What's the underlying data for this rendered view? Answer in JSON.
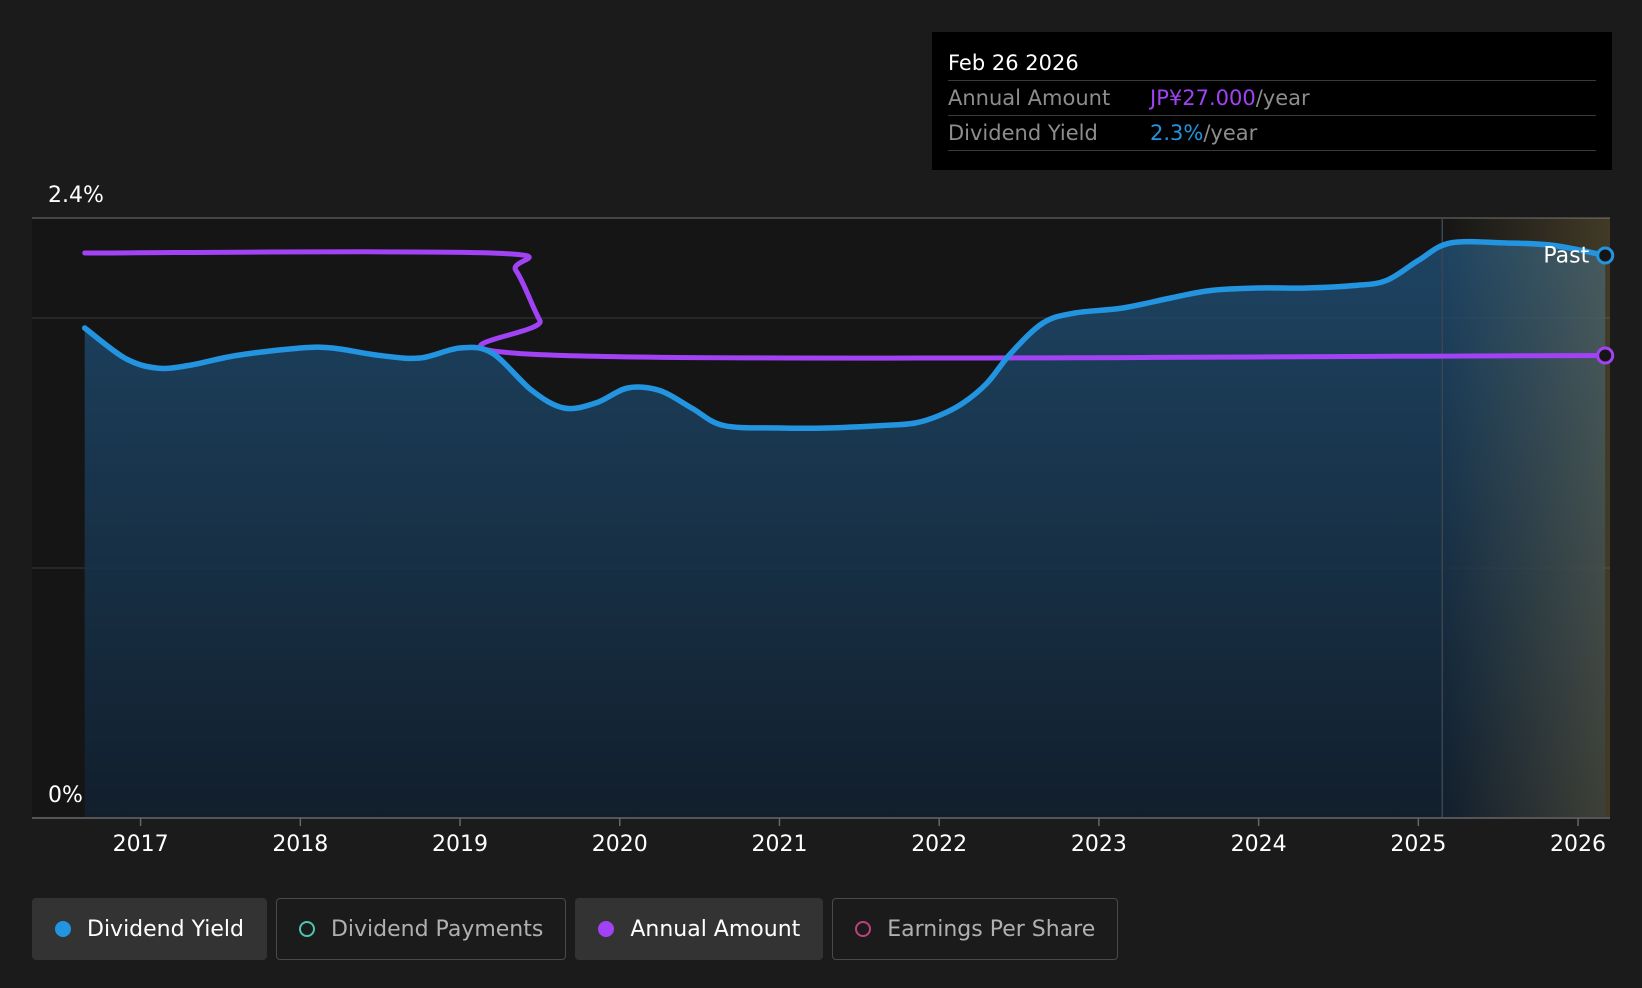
{
  "chart_data": {
    "type": "area",
    "y_tick_labels": [
      "2.4%",
      "0%"
    ],
    "ylim": [
      0,
      2.4
    ],
    "x_tick_labels": [
      "2017",
      "2018",
      "2019",
      "2020",
      "2021",
      "2022",
      "2023",
      "2024",
      "2025",
      "2026"
    ],
    "x_range": [
      2016.32,
      2026.2
    ],
    "past_label": "Past",
    "forecast_start": 2025.15,
    "series": [
      {
        "name": "Dividend Yield",
        "color": "#2394e0",
        "points": [
          [
            2016.65,
            1.96
          ],
          [
            2016.9,
            1.84
          ],
          [
            2017.1,
            1.8
          ],
          [
            2017.3,
            1.81
          ],
          [
            2017.6,
            1.85
          ],
          [
            2018.0,
            1.88
          ],
          [
            2018.2,
            1.88
          ],
          [
            2018.5,
            1.85
          ],
          [
            2018.75,
            1.84
          ],
          [
            2019.0,
            1.88
          ],
          [
            2019.2,
            1.86
          ],
          [
            2019.45,
            1.71
          ],
          [
            2019.65,
            1.64
          ],
          [
            2019.85,
            1.66
          ],
          [
            2020.05,
            1.72
          ],
          [
            2020.25,
            1.71
          ],
          [
            2020.45,
            1.64
          ],
          [
            2020.65,
            1.57
          ],
          [
            2021.0,
            1.56
          ],
          [
            2021.3,
            1.56
          ],
          [
            2021.65,
            1.57
          ],
          [
            2021.85,
            1.58
          ],
          [
            2022.0,
            1.61
          ],
          [
            2022.15,
            1.66
          ],
          [
            2022.3,
            1.74
          ],
          [
            2022.45,
            1.86
          ],
          [
            2022.65,
            1.98
          ],
          [
            2022.85,
            2.02
          ],
          [
            2023.15,
            2.04
          ],
          [
            2023.45,
            2.08
          ],
          [
            2023.7,
            2.11
          ],
          [
            2024.0,
            2.12
          ],
          [
            2024.3,
            2.12
          ],
          [
            2024.6,
            2.13
          ],
          [
            2024.8,
            2.15
          ],
          [
            2025.0,
            2.23
          ],
          [
            2025.2,
            2.3
          ],
          [
            2025.55,
            2.3
          ],
          [
            2025.85,
            2.29
          ],
          [
            2026.17,
            2.25
          ]
        ]
      },
      {
        "name": "Annual Amount",
        "color": "#a142f4",
        "points": [
          [
            2016.65,
            2.26
          ],
          [
            2019.2,
            2.26
          ],
          [
            2019.35,
            2.19
          ],
          [
            2019.5,
            1.99
          ],
          [
            2019.65,
            1.85
          ],
          [
            2026.17,
            1.85
          ]
        ]
      }
    ]
  },
  "tooltip": {
    "date": "Feb 26 2026",
    "rows": [
      {
        "label": "Annual Amount",
        "value": "JP¥27.000",
        "unit": "/year",
        "color": "#a142f4"
      },
      {
        "label": "Dividend Yield",
        "value": "2.3%",
        "unit": "/year",
        "color": "#2394e0"
      }
    ]
  },
  "legend": [
    {
      "label": "Dividend Yield",
      "color": "#2394e0",
      "filled": true,
      "active": true
    },
    {
      "label": "Dividend Payments",
      "color": "#4ec5b1",
      "filled": false,
      "active": false
    },
    {
      "label": "Annual Amount",
      "color": "#a142f4",
      "filled": true,
      "active": true
    },
    {
      "label": "Earnings Per Share",
      "color": "#c0427b",
      "filled": false,
      "active": false
    }
  ]
}
